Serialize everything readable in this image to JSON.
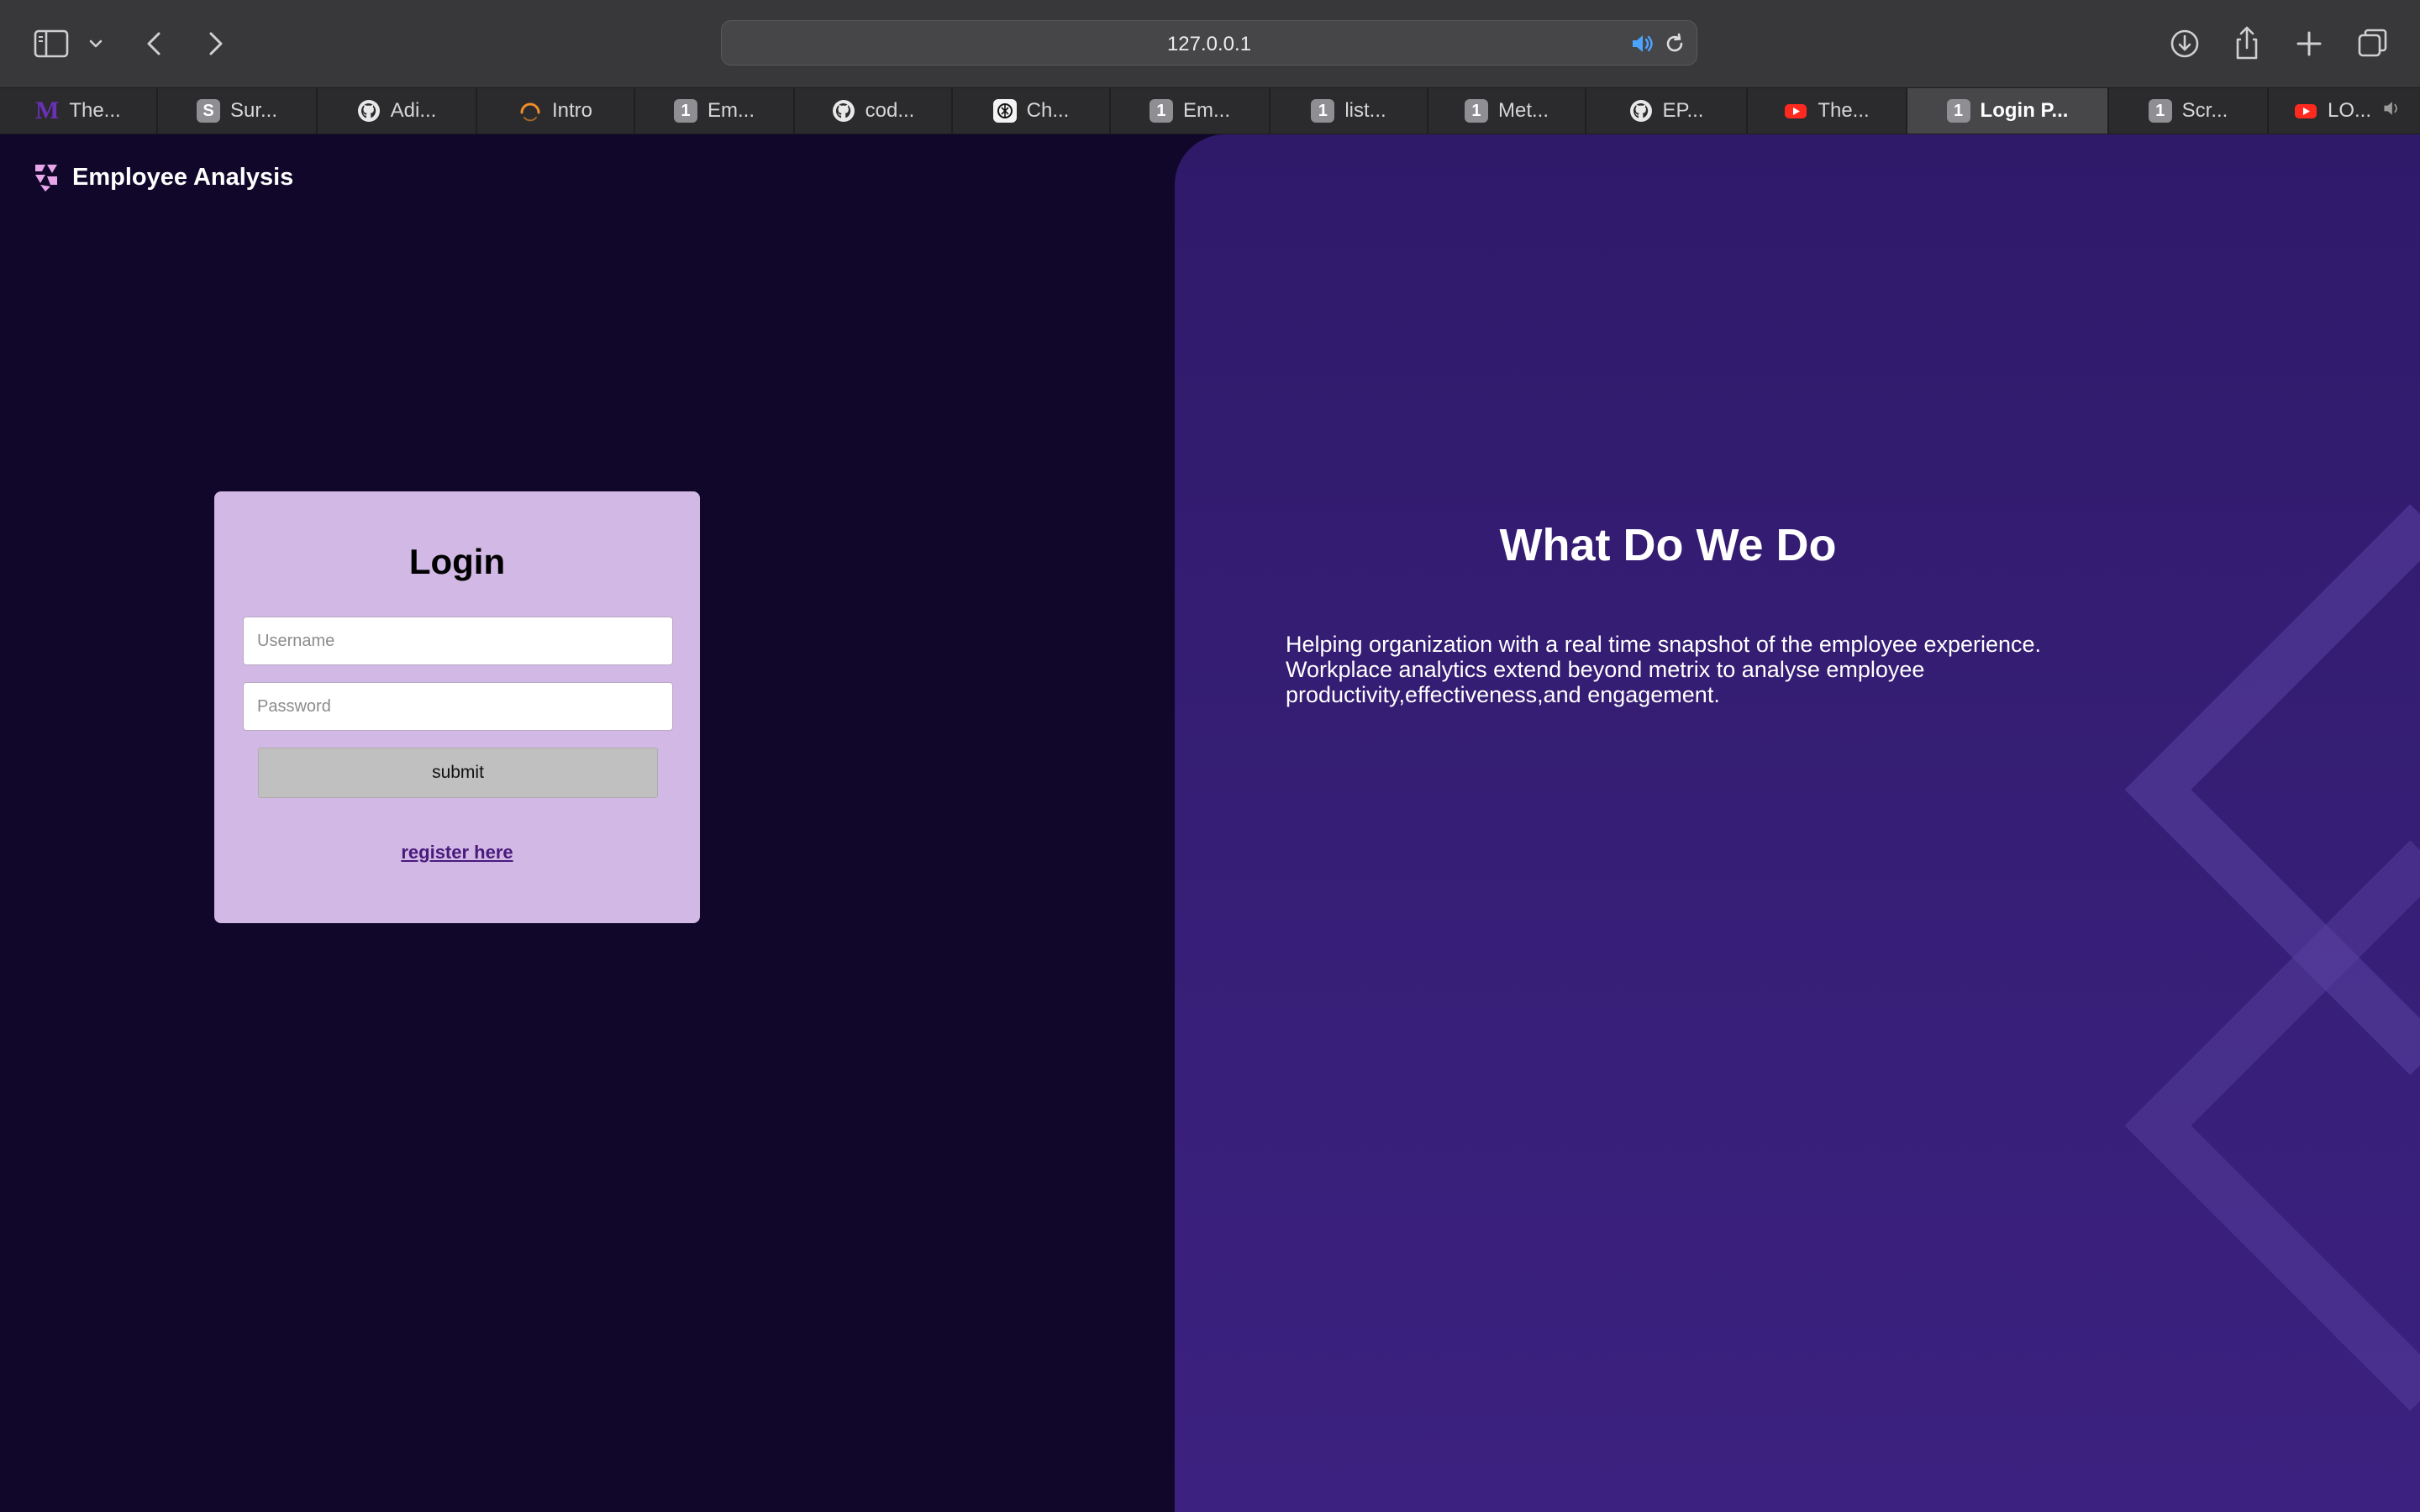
{
  "browser": {
    "url": "127.0.0.1",
    "tabs": [
      {
        "title": "The...",
        "favicon": "medium-m-icon",
        "favicon_text": "M",
        "active": false
      },
      {
        "title": "Sur...",
        "favicon": "letter-s-icon",
        "favicon_text": "S",
        "active": false
      },
      {
        "title": "Adi...",
        "favicon": "github-icon",
        "active": false
      },
      {
        "title": "Intro",
        "favicon": "loading-arc-icon",
        "active": false
      },
      {
        "title": "Em...",
        "favicon": "number-1-icon",
        "favicon_text": "1",
        "active": false
      },
      {
        "title": "cod...",
        "favicon": "github-icon",
        "active": false
      },
      {
        "title": "Ch...",
        "favicon": "openai-icon",
        "active": false
      },
      {
        "title": "Em...",
        "favicon": "number-1-icon",
        "favicon_text": "1",
        "active": false
      },
      {
        "title": "list...",
        "favicon": "number-1-icon",
        "favicon_text": "1",
        "active": false
      },
      {
        "title": "Met...",
        "favicon": "number-1-icon",
        "favicon_text": "1",
        "active": false
      },
      {
        "title": "EP...",
        "favicon": "github-icon",
        "active": false
      },
      {
        "title": "The...",
        "favicon": "youtube-icon",
        "active": false
      },
      {
        "title": "Login P...",
        "favicon": "number-1-icon",
        "favicon_text": "1",
        "active": true
      },
      {
        "title": "Scr...",
        "favicon": "number-1-icon",
        "favicon_text": "1",
        "active": false
      },
      {
        "title": "LO...",
        "favicon": "youtube-icon",
        "active": false,
        "playing_audio": true
      }
    ]
  },
  "header": {
    "brand_title": "Employee Analysis",
    "logo_icon": "brand-logo-icon"
  },
  "login": {
    "heading": "Login",
    "username_placeholder": "Username",
    "username_value": "",
    "password_placeholder": "Password",
    "password_value": "",
    "submit_label": "submit",
    "register_link": "register here"
  },
  "info": {
    "title": "What Do We Do",
    "body": "Helping organization with a real time snapshot of the employee experience. Workplace analytics extend beyond metrix to analyse employee productivity,effectiveness,and engagement."
  },
  "colors": {
    "page_bg": "#10072a",
    "card_bg": "#d2b8e4",
    "panel_bg": "#361e76",
    "link": "#4a1a7c",
    "submit_bg": "#c0c0c0"
  }
}
